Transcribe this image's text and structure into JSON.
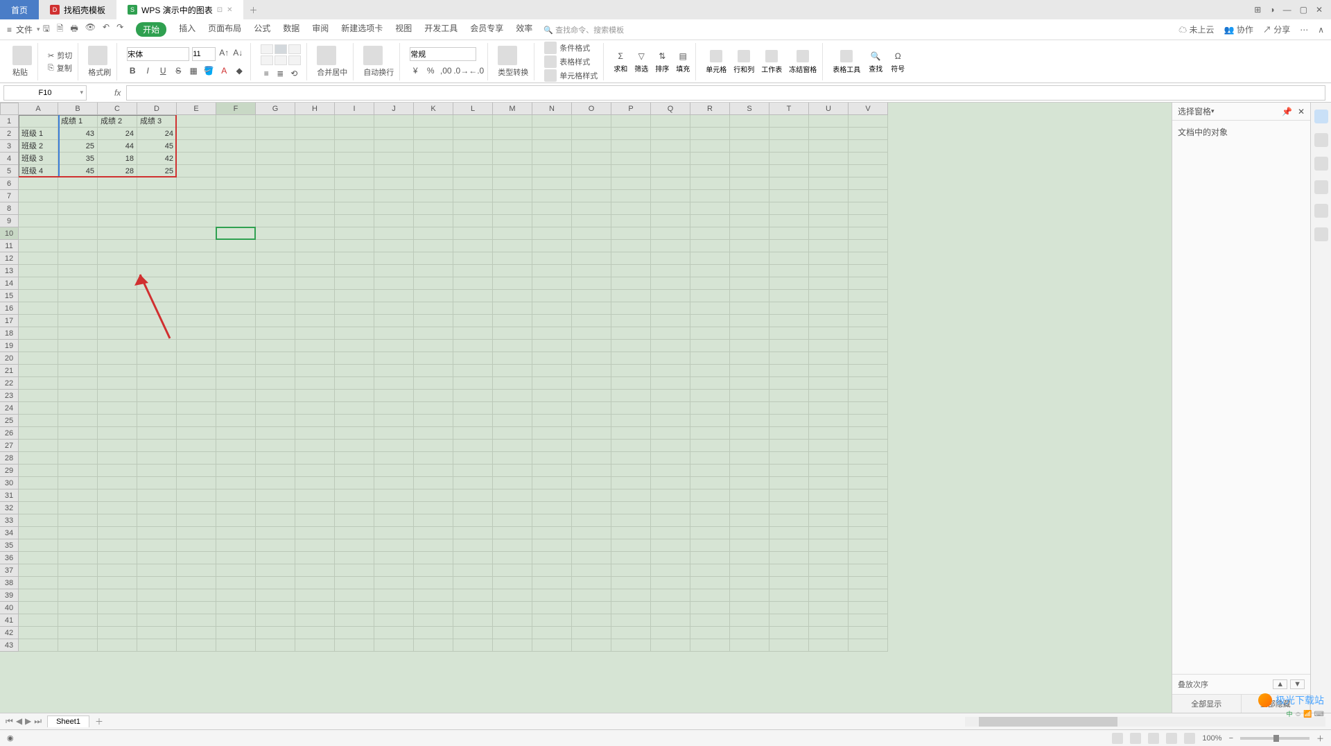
{
  "tabs": {
    "home": "首页",
    "second": "找稻壳模板",
    "third": "WPS 演示中的图表",
    "third_icon": "S"
  },
  "menu": {
    "file": "文件",
    "tabs": [
      "开始",
      "插入",
      "页面布局",
      "公式",
      "数据",
      "审阅",
      "新建选项卡",
      "视图",
      "开发工具",
      "会员专享",
      "效率"
    ],
    "search_hint": "查找命令、搜索模板",
    "right": {
      "cloud": "未上云",
      "coop": "协作",
      "share": "分享"
    }
  },
  "ribbon": {
    "paste": "粘贴",
    "cut": "剪切",
    "copy": "复制",
    "format_painter": "格式刷",
    "font_name": "宋体",
    "font_size": "11",
    "merge": "合并居中",
    "wrap": "自动换行",
    "number_format": "常规",
    "type_convert": "类型转换",
    "cond_format": "条件格式",
    "table_style": "表格样式",
    "cell_style": "单元格样式",
    "sum": "求和",
    "filter": "筛选",
    "sort": "排序",
    "fill": "填充",
    "cell": "单元格",
    "rowcol": "行和列",
    "worksheet": "工作表",
    "freeze": "冻结窗格",
    "table_tools": "表格工具",
    "find": "查找",
    "symbol": "符号"
  },
  "formula_bar": {
    "name_box": "F10",
    "fx": "fx"
  },
  "columns": [
    "A",
    "B",
    "C",
    "D",
    "E",
    "F",
    "G",
    "H",
    "I",
    "J",
    "K",
    "L",
    "M",
    "N",
    "O",
    "P",
    "Q",
    "R",
    "S",
    "T",
    "U",
    "V"
  ],
  "rows_count": 43,
  "selected_col_index": 5,
  "selected_row_index": 9,
  "chart_data": {
    "type": "table",
    "headers": [
      "",
      "成绩 1",
      "成绩 2",
      "成绩 3"
    ],
    "rows": [
      [
        "班级 1",
        43,
        24,
        24
      ],
      [
        "班级 2",
        25,
        44,
        45
      ],
      [
        "班级 3",
        35,
        18,
        42
      ],
      [
        "班级 4",
        45,
        28,
        25
      ]
    ]
  },
  "side": {
    "title": "选择窗格",
    "body": "文档中的对象",
    "footer": "叠放次序",
    "btn1": "全部显示",
    "btn2": "全部隐藏"
  },
  "sheet_tabs": {
    "sheet1": "Sheet1"
  },
  "status": {
    "zoom": "100%"
  },
  "watermark": {
    "name": "极光下载站",
    "sub": "中"
  }
}
